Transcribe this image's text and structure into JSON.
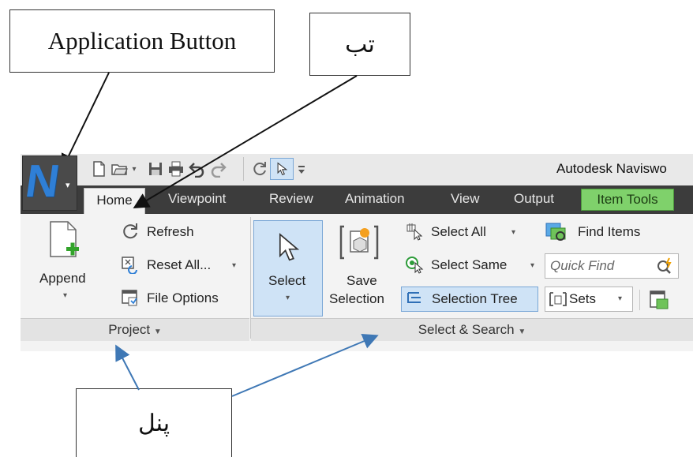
{
  "callouts": {
    "application_button": "Application Button",
    "tab": "تب",
    "panel": "پنل"
  },
  "window": {
    "title": "Autodesk Naviswo"
  },
  "tabs": [
    "Home",
    "Viewpoint",
    "Review",
    "Animation",
    "View",
    "Output",
    "Item Tools"
  ],
  "active_tab": "Home",
  "project_panel": {
    "append_label": "Append",
    "refresh_label": "Refresh",
    "reset_all_label": "Reset All...",
    "file_options_label": "File Options",
    "panel_title": "Project"
  },
  "select_search_panel": {
    "select_label": "Select",
    "save_selection_line1": "Save",
    "save_selection_line2": "Selection",
    "select_all_label": "Select All",
    "select_same_label": "Select Same",
    "selection_tree_label": "Selection Tree",
    "find_items_label": "Find Items",
    "quick_find_placeholder": "Quick Find",
    "sets_label": "Sets",
    "panel_title": "Select & Search"
  },
  "icons": {
    "app_button": "navisworks-n-logo",
    "qat": [
      "new-icon",
      "open-icon",
      "save-icon",
      "print-icon",
      "undo-icon",
      "redo-icon",
      "refresh-icon",
      "select-cursor-icon",
      "customize-icon"
    ]
  },
  "colors": {
    "tab_bar": "#3c3c3c",
    "item_tools_tab": "#7fd16b",
    "selected_button": "#cfe3f6",
    "logo_blue": "#2f7fd6",
    "annotation_black_arrow": "#111111",
    "annotation_blue_arrow": "#3f78b5"
  }
}
